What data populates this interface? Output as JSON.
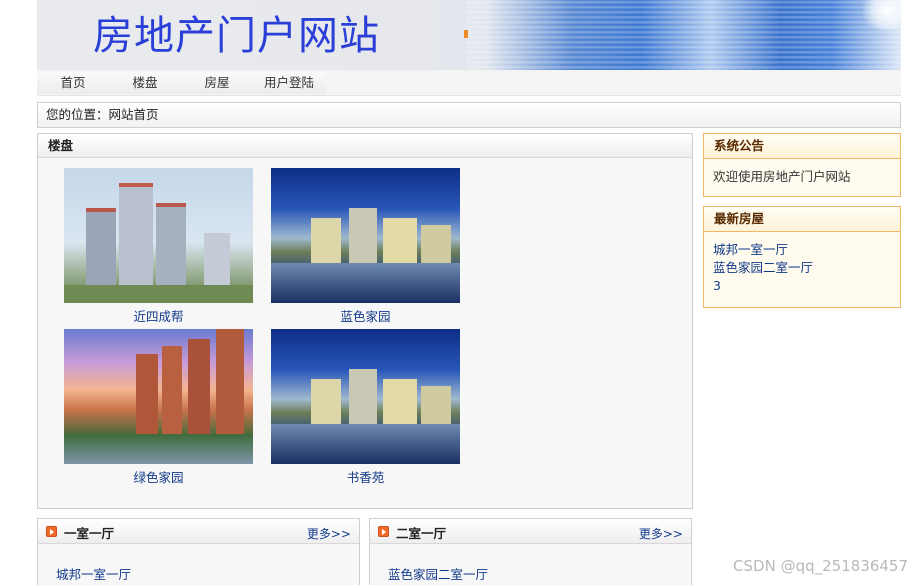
{
  "banner": {
    "title": "房地产门户网站"
  },
  "nav": {
    "items": [
      "首页",
      "楼盘",
      "房屋",
      "用户登陆"
    ]
  },
  "breadcrumb": {
    "label": "您的位置：",
    "current": "网站首页"
  },
  "estates": {
    "heading": "楼盘",
    "items": [
      {
        "name": "近四成帮"
      },
      {
        "name": "蓝色家园"
      },
      {
        "name": "绿色家园"
      },
      {
        "name": "书香苑"
      }
    ]
  },
  "notice": {
    "heading": "系统公告",
    "text": "欢迎使用房地产门户网站"
  },
  "latest_houses": {
    "heading": "最新房屋",
    "items": [
      "城邦一室一厅",
      "蓝色家园二室一厅",
      "3"
    ]
  },
  "bottom_panels": [
    {
      "title": "一室一厅",
      "more": "更多>>",
      "item": "城邦一室一厅"
    },
    {
      "title": "二室一厅",
      "more": "更多>>",
      "item": "蓝色家园二室一厅"
    }
  ],
  "watermark": "CSDN @qq_251836457"
}
